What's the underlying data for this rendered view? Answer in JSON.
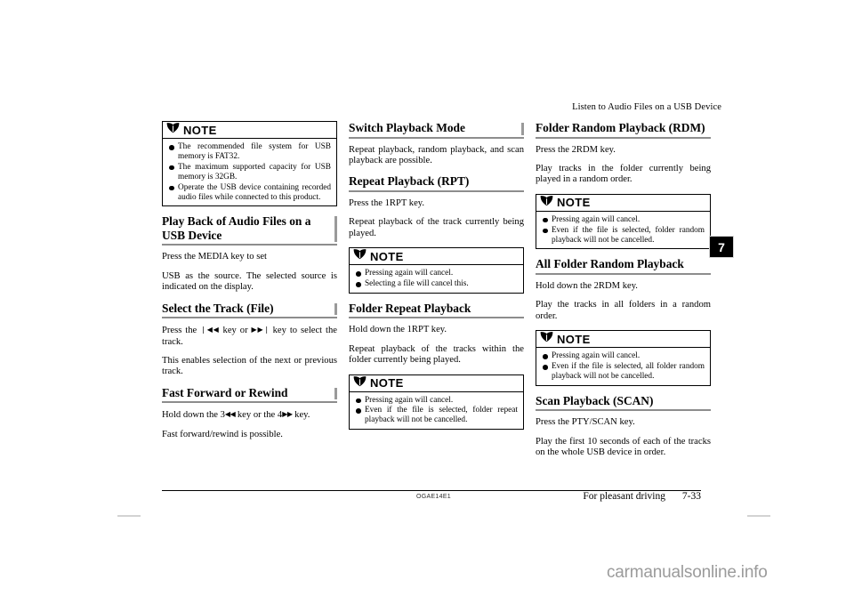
{
  "header": {
    "running_title": "Listen to Audio Files on a USB Device"
  },
  "chapter_tab": {
    "number": "7"
  },
  "footer": {
    "doc_code": "OGAE14E1",
    "section_name": "For pleasant driving",
    "page_number": "7-33"
  },
  "watermark": {
    "text": "carmanualsonline.info"
  },
  "note_label": "NOTE",
  "columns": {
    "left": {
      "note_usb": {
        "title": "NOTE",
        "items": [
          "The recommended file system for USB memory is FAT32.",
          "The maximum supported capacity for USB memory is 32GB.",
          "Operate the USB device containing recorded audio files while connected to this product."
        ]
      },
      "heading_playback": "Play Back of Audio Files on a USB Device",
      "para_media_key": "Press the MEDIA key to set",
      "para_usb_source": "USB as the source. The selected source is indicated on the display.",
      "heading_select_track": "Select the Track (File)",
      "para_select_track_pre": "Press the ",
      "para_select_track_mid": " key or ",
      "para_select_track_post": " key to select the track.",
      "glyph_prev": "❘◀◀",
      "glyph_next": "▶▶❘",
      "para_next_previous": "This enables selection of the next or previous track.",
      "heading_fast_forward": "Fast Forward or Rewind",
      "para_hold_pre": "Hold down the 3",
      "para_hold_mid": " key or the 4",
      "para_hold_post": " key.",
      "glyph_rewind": "◀◀",
      "glyph_forward": "▶▶",
      "para_ff_possible": "Fast forward/rewind is possible."
    },
    "middle": {
      "heading_switch_mode": "Switch Playback Mode",
      "para_modes": "Repeat playback, random playback, and scan playback are possible.",
      "heading_repeat": "Repeat Playback (RPT)",
      "para_press_rpt": "Press the 1RPT key.",
      "para_repeat_track": "Repeat playback of the track currently being played.",
      "note_repeat": {
        "title": "NOTE",
        "items": [
          "Pressing again will cancel.",
          "Selecting a file will cancel this."
        ]
      },
      "heading_folder_repeat": "Folder Repeat Playback",
      "para_hold_rpt": "Hold down the 1RPT key.",
      "para_folder_repeat": "Repeat playback of the tracks within the folder currently being played.",
      "note_folder_repeat": {
        "title": "NOTE",
        "items": [
          "Pressing again will cancel.",
          "Even if the file is selected, folder repeat playback will not be cancelled."
        ]
      }
    },
    "right": {
      "heading_folder_random": "Folder Random Playback (RDM)",
      "para_press_rdm": "Press the 2RDM key.",
      "para_folder_random": "Play tracks in the folder currently being played in a random order.",
      "note_folder_random": {
        "title": "NOTE",
        "items": [
          "Pressing again will cancel.",
          "Even if the file is selected, folder random playback will not be cancelled."
        ]
      },
      "heading_all_folder_random": "All Folder Random Playback",
      "para_hold_rdm": "Hold down the 2RDM key.",
      "para_all_folder_random": "Play the tracks in all folders in a random order.",
      "note_all_folder_random": {
        "title": "NOTE",
        "items": [
          "Pressing again will cancel.",
          "Even if the file is selected, all folder random playback will not be cancelled."
        ]
      },
      "heading_scan": "Scan Playback (SCAN)",
      "para_press_scan": "Press the PTY/SCAN key.",
      "para_scan": "Play the first 10 seconds of each of the tracks on the whole USB device in order."
    }
  }
}
